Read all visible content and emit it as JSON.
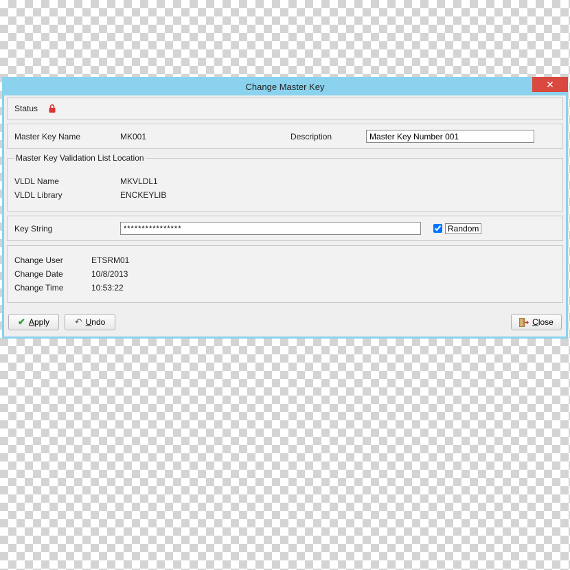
{
  "window": {
    "title": "Change Master Key",
    "close_label": "✕"
  },
  "status": {
    "label": "Status"
  },
  "master": {
    "name_label": "Master Key Name",
    "name_value": "MK001",
    "desc_label": "Description",
    "desc_value": "Master Key Number 001"
  },
  "vldl": {
    "legend": "Master Key Validation List Location",
    "name_label": "VLDL Name",
    "name_value": "MKVLDL1",
    "lib_label": "VLDL Library",
    "lib_value": "ENCKEYLIB"
  },
  "keystring": {
    "label": "Key String",
    "value": "****************",
    "random_checked": true,
    "random_label": "Random"
  },
  "change": {
    "user_label": "Change User",
    "user_value": "ETSRM01",
    "date_label": "Change Date",
    "date_value": "10/8/2013",
    "time_label": "Change Time",
    "time_value": "10:53:22"
  },
  "buttons": {
    "apply": "Apply",
    "apply_u": "A",
    "apply_rest": "pply",
    "undo": "Undo",
    "undo_u": "U",
    "undo_rest": "ndo",
    "close": "Close",
    "close_u": "C",
    "close_rest": "lose"
  }
}
